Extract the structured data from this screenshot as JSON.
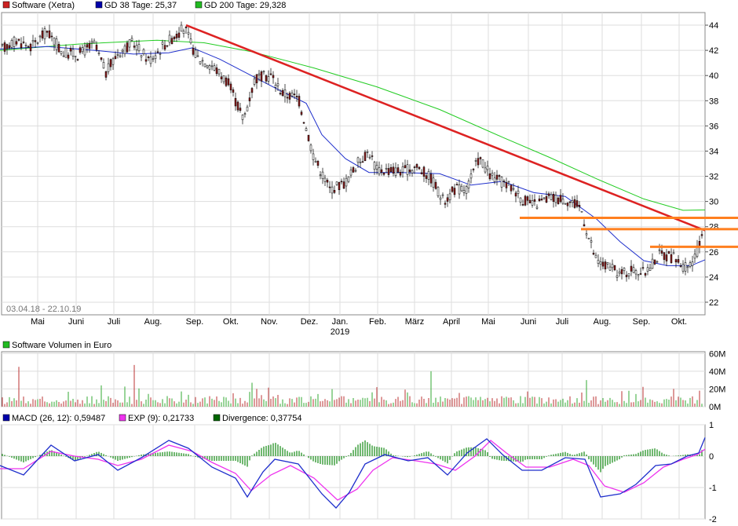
{
  "chart_data": [
    {
      "type": "candlestick",
      "legend": [
        {
          "label": "Software (Xetra)",
          "color": "#cc2222"
        },
        {
          "label": "GD 38 Tage: 25,37",
          "color": "#0000aa"
        },
        {
          "label": "GD 200 Tage: 29,328",
          "color": "#22bb22"
        }
      ],
      "date_range": "03.04.18 - 22.10.19",
      "x_labels": [
        "Mai",
        "Juni",
        "Juli",
        "Aug.",
        "Sep.",
        "Okt.",
        "Nov.",
        "Dez.",
        "Jan.",
        "Feb.",
        "März",
        "April",
        "Mai",
        "Juni",
        "Juli",
        "Aug.",
        "Sep.",
        "Okt."
      ],
      "x_sublabel": "2019",
      "y_ticks": [
        22,
        24,
        26,
        28,
        30,
        32,
        34,
        36,
        38,
        40,
        42,
        44
      ],
      "ylim": [
        21,
        45
      ],
      "price_points": [
        [
          0,
          42.0
        ],
        [
          20,
          42.8
        ],
        [
          40,
          42.3
        ],
        [
          60,
          43.5
        ],
        [
          80,
          41.8
        ],
        [
          100,
          41.7
        ],
        [
          120,
          42.5
        ],
        [
          135,
          40.2
        ],
        [
          150,
          41.8
        ],
        [
          170,
          42.6
        ],
        [
          190,
          41.2
        ],
        [
          210,
          42.5
        ],
        [
          235,
          43.8
        ],
        [
          250,
          41.5
        ],
        [
          270,
          40.8
        ],
        [
          290,
          39.5
        ],
        [
          310,
          36.5
        ],
        [
          325,
          39.8
        ],
        [
          345,
          40.0
        ],
        [
          360,
          38.6
        ],
        [
          380,
          38.2
        ],
        [
          400,
          33.5
        ],
        [
          420,
          31.0
        ],
        [
          440,
          31.5
        ],
        [
          455,
          33.0
        ],
        [
          470,
          34.0
        ],
        [
          480,
          32.5
        ],
        [
          495,
          32.5
        ],
        [
          515,
          32.4
        ],
        [
          530,
          32.8
        ],
        [
          550,
          31.8
        ],
        [
          565,
          30.0
        ],
        [
          580,
          31.0
        ],
        [
          595,
          31.0
        ],
        [
          610,
          33.5
        ],
        [
          625,
          32.0
        ],
        [
          640,
          31.5
        ],
        [
          655,
          31.0
        ],
        [
          665,
          30.2
        ],
        [
          680,
          29.7
        ],
        [
          700,
          30.3
        ],
        [
          720,
          30.2
        ],
        [
          740,
          29.5
        ],
        [
          748,
          27.5
        ],
        [
          760,
          25.2
        ],
        [
          775,
          24.8
        ],
        [
          790,
          24.2
        ],
        [
          805,
          24.6
        ],
        [
          820,
          24.3
        ],
        [
          840,
          25.8
        ],
        [
          860,
          25.5
        ],
        [
          875,
          24.6
        ],
        [
          885,
          25.6
        ],
        [
          893,
          26.8
        ],
        [
          898,
          30.3
        ]
      ],
      "gd38_points": [
        [
          0,
          42.1
        ],
        [
          60,
          42.3
        ],
        [
          120,
          42.0
        ],
        [
          170,
          41.7
        ],
        [
          215,
          41.8
        ],
        [
          245,
          42.2
        ],
        [
          280,
          41.3
        ],
        [
          320,
          40.0
        ],
        [
          360,
          38.7
        ],
        [
          390,
          37.8
        ],
        [
          410,
          35.3
        ],
        [
          440,
          33.4
        ],
        [
          470,
          32.3
        ],
        [
          510,
          32.3
        ],
        [
          560,
          32.2
        ],
        [
          600,
          31.3
        ],
        [
          640,
          31.6
        ],
        [
          680,
          30.7
        ],
        [
          720,
          30.4
        ],
        [
          760,
          28.6
        ],
        [
          790,
          26.8
        ],
        [
          820,
          25.3
        ],
        [
          850,
          24.9
        ],
        [
          880,
          24.9
        ],
        [
          898,
          25.37
        ]
      ],
      "gd200_points": [
        [
          0,
          42.0
        ],
        [
          100,
          42.5
        ],
        [
          200,
          42.8
        ],
        [
          260,
          42.6
        ],
        [
          320,
          41.9
        ],
        [
          400,
          40.6
        ],
        [
          480,
          39.1
        ],
        [
          560,
          37.3
        ],
        [
          640,
          35.1
        ],
        [
          700,
          33.5
        ],
        [
          760,
          31.8
        ],
        [
          820,
          30.2
        ],
        [
          870,
          29.3
        ],
        [
          898,
          29.328
        ]
      ],
      "trend_line": [
        [
          237,
          44.0
        ],
        [
          898,
          27.7
        ]
      ],
      "horizontal_lines": [
        [
          662,
          28.7
        ],
        [
          740,
          27.8
        ],
        [
          828,
          26.4
        ]
      ]
    },
    {
      "type": "bar",
      "title": "Software Volumen in Euro",
      "legend_color": "#22bb22",
      "y_ticks": [
        "0M",
        "20M",
        "40M",
        "60M"
      ],
      "ylim": [
        0,
        62
      ],
      "spikes": [
        [
          25,
          45
        ],
        [
          172,
          47
        ],
        [
          550,
          40
        ],
        [
          748,
          30
        ],
        [
          322,
          27
        ],
        [
          128,
          24
        ],
        [
          480,
          22
        ],
        [
          890,
          18
        ]
      ]
    },
    {
      "type": "line",
      "legend": [
        {
          "label": "MACD (26, 12): 0,59487",
          "color": "#0000aa"
        },
        {
          "label": "EXP (9): 0,21733",
          "color": "#ee33ee"
        },
        {
          "label": "Divergence: 0,37754",
          "color": "#006600"
        }
      ],
      "y_ticks": [
        -2,
        -1,
        0,
        1
      ],
      "ylim": [
        -2,
        1
      ],
      "macd_points": [
        [
          0,
          -0.3
        ],
        [
          30,
          -0.6
        ],
        [
          65,
          0.35
        ],
        [
          95,
          -0.15
        ],
        [
          125,
          0.05
        ],
        [
          150,
          -0.45
        ],
        [
          180,
          -0.05
        ],
        [
          215,
          0.5
        ],
        [
          240,
          0.25
        ],
        [
          270,
          -0.35
        ],
        [
          300,
          -0.7
        ],
        [
          315,
          -1.3
        ],
        [
          335,
          -0.5
        ],
        [
          350,
          -0.1
        ],
        [
          380,
          -0.25
        ],
        [
          410,
          -1.2
        ],
        [
          428,
          -1.65
        ],
        [
          445,
          -1.15
        ],
        [
          465,
          -0.25
        ],
        [
          490,
          0.05
        ],
        [
          520,
          -0.15
        ],
        [
          545,
          -0.05
        ],
        [
          570,
          -0.6
        ],
        [
          595,
          0.1
        ],
        [
          620,
          0.55
        ],
        [
          640,
          0.05
        ],
        [
          665,
          -0.45
        ],
        [
          690,
          -0.45
        ],
        [
          720,
          -0.05
        ],
        [
          745,
          -0.1
        ],
        [
          765,
          -1.3
        ],
        [
          790,
          -1.2
        ],
        [
          810,
          -0.9
        ],
        [
          835,
          -0.3
        ],
        [
          855,
          -0.25
        ],
        [
          875,
          0.0
        ],
        [
          890,
          0.1
        ],
        [
          898,
          0.59
        ]
      ],
      "exp_points": [
        [
          0,
          -0.4
        ],
        [
          30,
          -0.4
        ],
        [
          65,
          0.15
        ],
        [
          95,
          0.0
        ],
        [
          125,
          -0.1
        ],
        [
          150,
          -0.3
        ],
        [
          180,
          -0.1
        ],
        [
          215,
          0.35
        ],
        [
          245,
          0.15
        ],
        [
          270,
          -0.2
        ],
        [
          300,
          -0.55
        ],
        [
          320,
          -1.1
        ],
        [
          345,
          -0.6
        ],
        [
          370,
          -0.3
        ],
        [
          400,
          -0.7
        ],
        [
          430,
          -1.4
        ],
        [
          455,
          -1.05
        ],
        [
          475,
          -0.45
        ],
        [
          500,
          -0.05
        ],
        [
          530,
          -0.15
        ],
        [
          555,
          -0.25
        ],
        [
          580,
          -0.45
        ],
        [
          605,
          0.0
        ],
        [
          625,
          0.5
        ],
        [
          645,
          0.1
        ],
        [
          670,
          -0.35
        ],
        [
          700,
          -0.35
        ],
        [
          730,
          -0.1
        ],
        [
          750,
          -0.3
        ],
        [
          770,
          -0.95
        ],
        [
          795,
          -1.15
        ],
        [
          820,
          -0.85
        ],
        [
          845,
          -0.35
        ],
        [
          870,
          -0.1
        ],
        [
          888,
          0.05
        ],
        [
          898,
          0.22
        ]
      ]
    }
  ]
}
